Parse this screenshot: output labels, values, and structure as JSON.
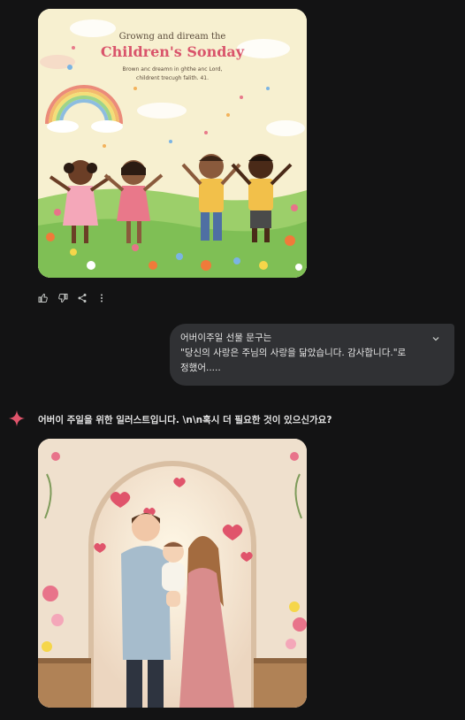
{
  "image1": {
    "title_top": "Growng and diream the",
    "title_main": "Children's Sonday",
    "subtitle_line1": "Brown anc dreamn in ghthe anc Lord,",
    "subtitle_line2": "childrent trecugh falith. 41."
  },
  "actions": [
    "thumbs-up-icon",
    "thumbs-down-icon",
    "share-icon",
    "more-vert-icon"
  ],
  "user_message": {
    "line1": "어버이주일 선물 문구는",
    "line2": "\"당신의 사랑은 주님의 사랑을 닮았습니다. 감사합니다.\"로",
    "line3": "정했어....."
  },
  "assistant": {
    "text": "어버이 주일을 위한 일러스트입니다. \\n\\n혹시 더 필요한 것이 있으신가요?"
  },
  "colors": {
    "background": "#131314",
    "bubble": "#303134",
    "text": "#e3e3e3",
    "sparkle": "#e0546b"
  }
}
